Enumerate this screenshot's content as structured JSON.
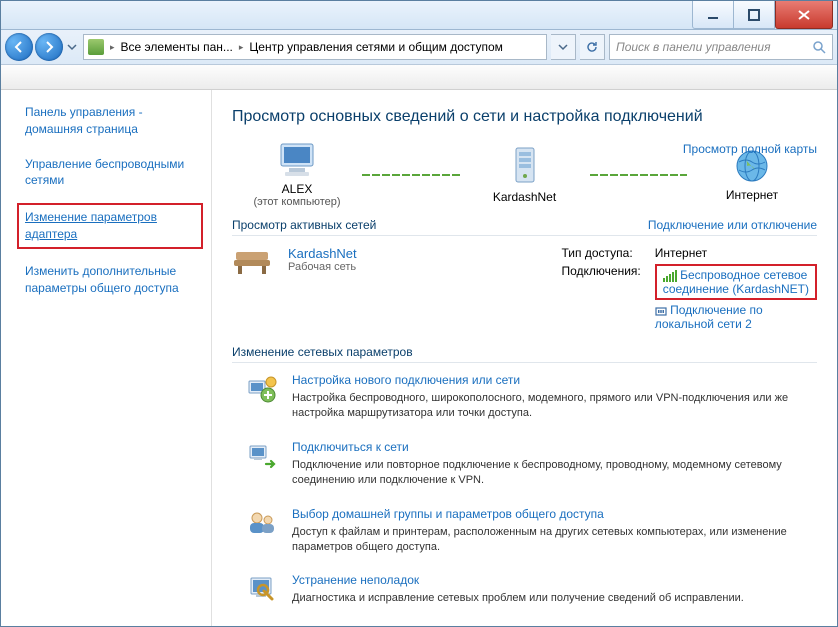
{
  "titlebar": {},
  "nav": {
    "crumb1": "Все элементы пан...",
    "crumb2": "Центр управления сетями и общим доступом",
    "search_placeholder": "Поиск в панели управления"
  },
  "sidebar": {
    "home_l1": "Панель управления -",
    "home_l2": "домашняя страница",
    "link_wireless_l1": "Управление беспроводными",
    "link_wireless_l2": "сетями",
    "link_adapter_l1": "Изменение параметров",
    "link_adapter_l2": "адаптера",
    "link_sharing_l1": "Изменить дополнительные",
    "link_sharing_l2": "параметры общего доступа"
  },
  "main": {
    "heading": "Просмотр основных сведений о сети и настройка подключений",
    "full_map": "Просмотр полной карты",
    "node_pc": "ALEX",
    "node_pc_sub": "(этот компьютер)",
    "node_gw": "KardashNet",
    "node_net": "Интернет",
    "active_head": "Просмотр активных сетей",
    "active_head_link": "Подключение или отключение",
    "active": {
      "name": "KardashNet",
      "type": "Рабочая сеть",
      "k_access": "Тип доступа:",
      "v_access": "Интернет",
      "k_conn": "Подключения:",
      "v_conn_wifi_l1": "Беспроводное сетевое",
      "v_conn_wifi_l2": "соединение (KardashNET)",
      "v_conn_lan_l1": "Подключение по",
      "v_conn_lan_l2": "локальной сети 2"
    },
    "change_head": "Изменение сетевых параметров",
    "tasks": [
      {
        "title": "Настройка нового подключения или сети",
        "desc": "Настройка беспроводного, широкополосного, модемного, прямого или VPN-подключения или же настройка маршрутизатора или точки доступа."
      },
      {
        "title": "Подключиться к сети",
        "desc": "Подключение или повторное подключение к беспроводному, проводному, модемному сетевому соединению или подключение к VPN."
      },
      {
        "title": "Выбор домашней группы и параметров общего доступа",
        "desc": "Доступ к файлам и принтерам, расположенным на других сетевых компьютерах, или изменение параметров общего доступа."
      },
      {
        "title": "Устранение неполадок",
        "desc": "Диагностика и исправление сетевых проблем или получение сведений об исправлении."
      }
    ]
  }
}
